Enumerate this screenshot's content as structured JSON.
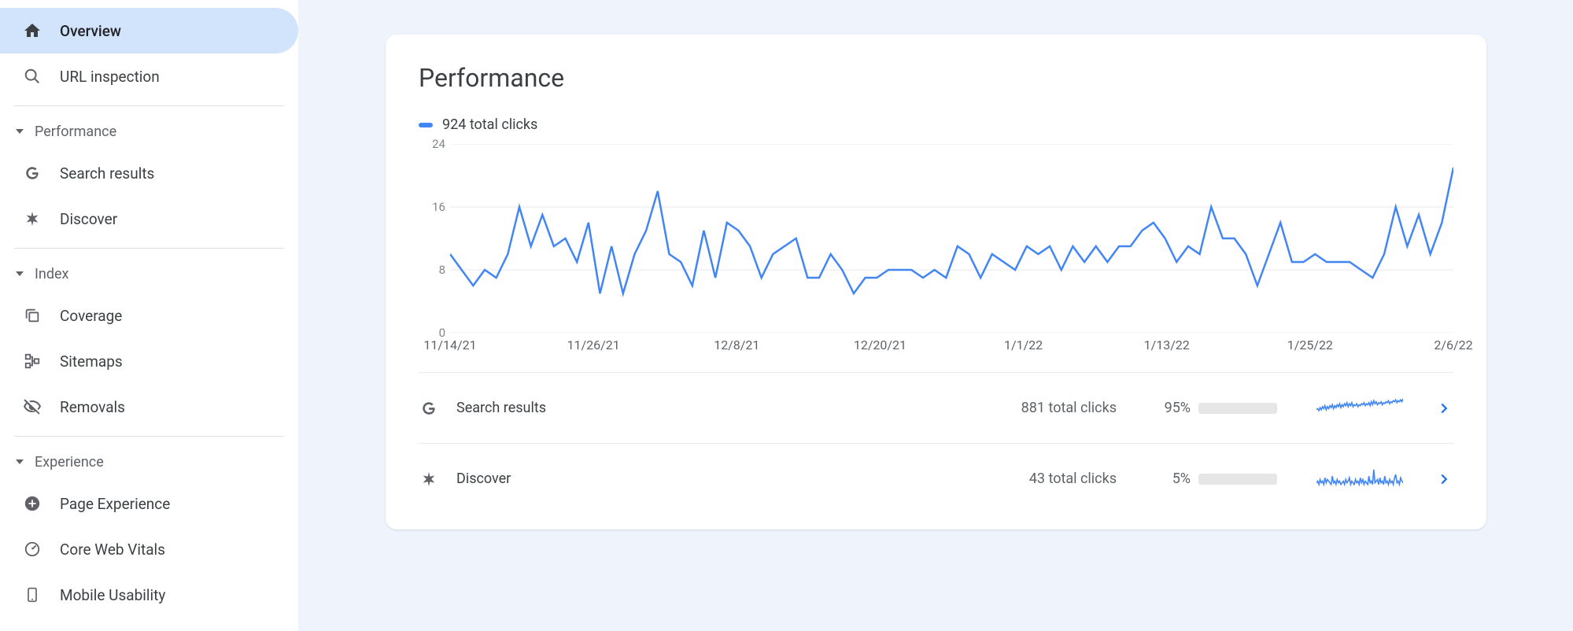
{
  "sidebar": {
    "overview": "Overview",
    "url_inspect": "URL inspection",
    "sections": {
      "performance": "Performance",
      "index": "Index",
      "experience": "Experience"
    },
    "performance_items": {
      "search_results": "Search results",
      "discover": "Discover"
    },
    "index_items": {
      "coverage": "Coverage",
      "sitemaps": "Sitemaps",
      "removals": "Removals"
    },
    "experience_items": {
      "page_experience": "Page Experience",
      "core_web_vitals": "Core Web Vitals",
      "mobile_usability": "Mobile Usability"
    }
  },
  "card": {
    "title": "Performance",
    "legend": "924 total clicks"
  },
  "chart_data": {
    "type": "line",
    "ylabel": "",
    "xlabel": "",
    "ylim": [
      0,
      24
    ],
    "yticks": [
      0,
      8,
      16,
      24
    ],
    "xticks": [
      "11/14/21",
      "11/26/21",
      "12/8/21",
      "12/20/21",
      "1/1/22",
      "1/13/22",
      "1/25/22",
      "2/6/22"
    ],
    "series": [
      {
        "name": "total clicks",
        "color": "#4285f4",
        "values": [
          10,
          8,
          6,
          8,
          7,
          10,
          16,
          11,
          15,
          11,
          12,
          9,
          14,
          5,
          11,
          5,
          10,
          13,
          18,
          10,
          9,
          6,
          13,
          7,
          14,
          13,
          11,
          7,
          10,
          11,
          12,
          7,
          7,
          10,
          8,
          5,
          7,
          7,
          8,
          8,
          8,
          7,
          8,
          7,
          11,
          10,
          7,
          10,
          9,
          8,
          11,
          10,
          11,
          8,
          11,
          9,
          11,
          9,
          11,
          11,
          13,
          14,
          12,
          9,
          11,
          10,
          16,
          12,
          12,
          10,
          6,
          10,
          14,
          9,
          9,
          10,
          9,
          9,
          9,
          8,
          7,
          10,
          16,
          11,
          15,
          10,
          14,
          21
        ]
      }
    ]
  },
  "rows": [
    {
      "label": "Search results",
      "clicks": "881 total clicks",
      "pct_label": "95%",
      "pct": 95,
      "icon": "google"
    },
    {
      "label": "Discover",
      "clicks": "43 total clicks",
      "pct_label": "5%",
      "pct": 5,
      "icon": "asterisk"
    }
  ],
  "sparks": {
    "search": [
      9,
      10,
      8,
      11,
      9,
      12,
      10,
      13,
      9,
      12,
      10,
      13,
      11,
      14,
      10,
      13,
      11,
      14,
      12,
      15,
      11,
      14,
      12,
      15,
      13,
      16,
      12,
      15,
      13,
      16,
      12,
      14,
      13,
      15,
      12,
      14,
      13,
      15,
      14,
      16,
      13,
      15,
      14,
      16,
      13,
      17,
      14,
      18,
      15,
      17,
      14,
      16,
      15,
      17,
      14,
      16,
      15,
      17,
      16,
      18,
      15,
      17,
      16,
      18,
      17,
      19,
      16,
      18,
      17,
      19,
      17,
      20
    ],
    "discover": [
      4,
      5,
      3,
      6,
      4,
      5,
      3,
      7,
      4,
      6,
      5,
      4,
      3,
      8,
      4,
      5,
      3,
      6,
      4,
      5,
      3,
      4,
      5,
      3,
      6,
      4,
      5,
      7,
      3,
      5,
      4,
      3,
      6,
      4,
      5,
      3,
      7,
      4,
      6,
      3,
      5,
      4,
      3,
      8,
      4,
      5,
      3,
      12,
      4,
      5,
      6,
      3,
      7,
      4,
      5,
      3,
      8,
      4,
      5,
      3,
      6,
      4,
      5,
      3,
      7,
      9,
      4,
      5,
      3,
      7,
      5,
      4
    ]
  }
}
